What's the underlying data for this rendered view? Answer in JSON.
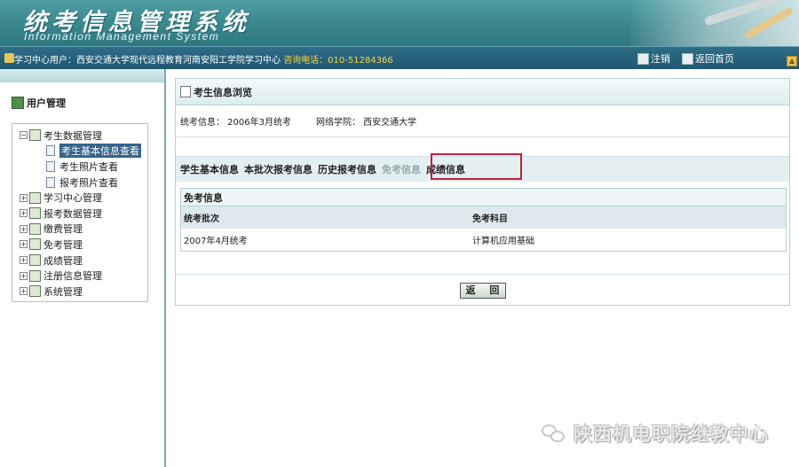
{
  "header": {
    "title_cn": "统考信息管理系统",
    "title_en": "Information Management System"
  },
  "topbar": {
    "user_label": "学习中心用户：西安交通大学现代远程教育河南安阳工学院学习中心",
    "phone_label": "咨询电话：010-51284366",
    "logout": "注销",
    "home": "返回首页"
  },
  "sidebar": {
    "title": "用户管理",
    "items": [
      {
        "label": "考生数据管理",
        "expanded": true,
        "children": [
          {
            "label": "考生基本信息查看",
            "selected": true
          },
          {
            "label": "考生照片查看"
          },
          {
            "label": "报考照片查看"
          }
        ]
      },
      {
        "label": "学习中心管理"
      },
      {
        "label": "报考数据管理"
      },
      {
        "label": "缴费管理"
      },
      {
        "label": "免考管理"
      },
      {
        "label": "成绩管理"
      },
      {
        "label": "注册信息管理"
      },
      {
        "label": "系统管理"
      }
    ]
  },
  "main": {
    "title": "考生信息浏览",
    "info_exam": "统考信息：  2006年3月统考",
    "info_school": "网络学院：  西安交通大学",
    "tabs": [
      "学生基本信息",
      "本批次报考信息",
      "历史报考信息",
      "免考信息",
      "成绩信息"
    ],
    "table": {
      "caption": "免考信息",
      "headers": [
        "统考批次",
        "免考科目"
      ],
      "rows": [
        [
          "2007年4月统考",
          "计算机应用基础"
        ]
      ]
    },
    "back_button": "返 回"
  },
  "watermark": "陕西机电职院继教中心"
}
